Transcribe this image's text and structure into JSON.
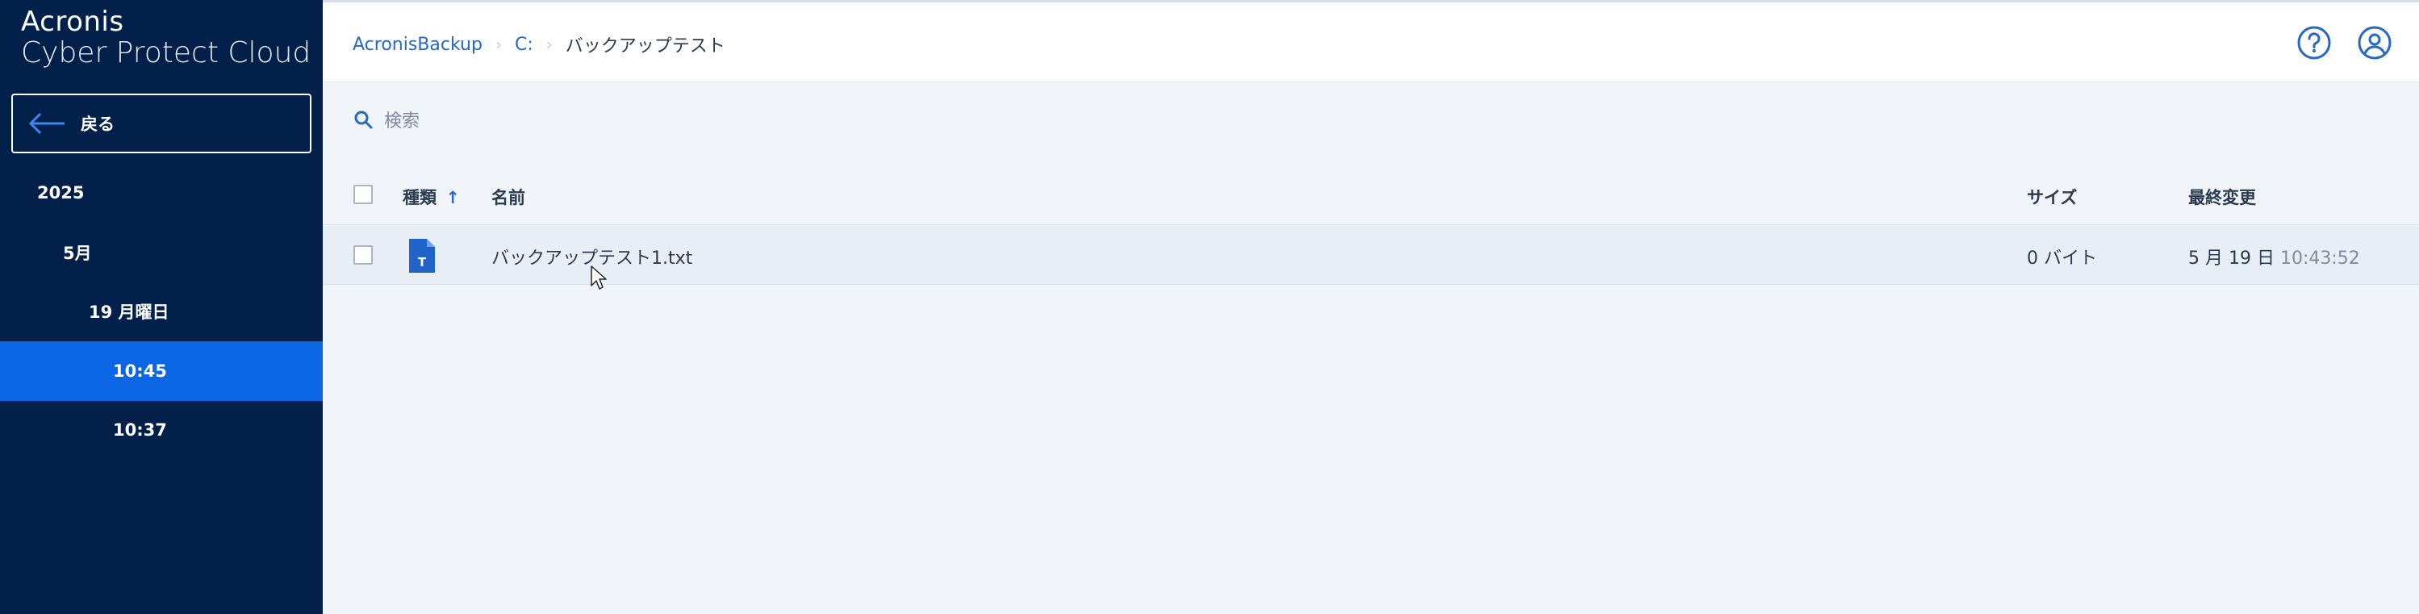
{
  "sidebar": {
    "logo_line1": "Acronis",
    "logo_line2": "Cyber Protect Cloud",
    "back_label": "戻る",
    "tree": {
      "year": "2025",
      "month": "5月",
      "day": "19 月曜日",
      "time_selected": "10:45",
      "time_other": "10:37"
    }
  },
  "header": {
    "breadcrumb": {
      "item1": "AcronisBackup",
      "item2": "C:",
      "current": "バックアップテスト"
    },
    "icons": [
      "help-icon",
      "user-icon"
    ]
  },
  "search": {
    "placeholder": "検索"
  },
  "table": {
    "columns": {
      "type": "種類",
      "name": "名前",
      "size": "サイズ",
      "modified": "最終変更"
    },
    "sort_indicator": "↑",
    "rows": [
      {
        "name": "バックアップテスト1.txt",
        "file_icon_letter": "T",
        "size": "0 バイト",
        "date": "5 月 19 日",
        "time": "10:43:52"
      }
    ]
  },
  "colors": {
    "sidebar_bg": "#03204b",
    "selected_bg": "#0b66e4",
    "accent": "#2668c4",
    "content_bg": "#f1f5fa"
  }
}
